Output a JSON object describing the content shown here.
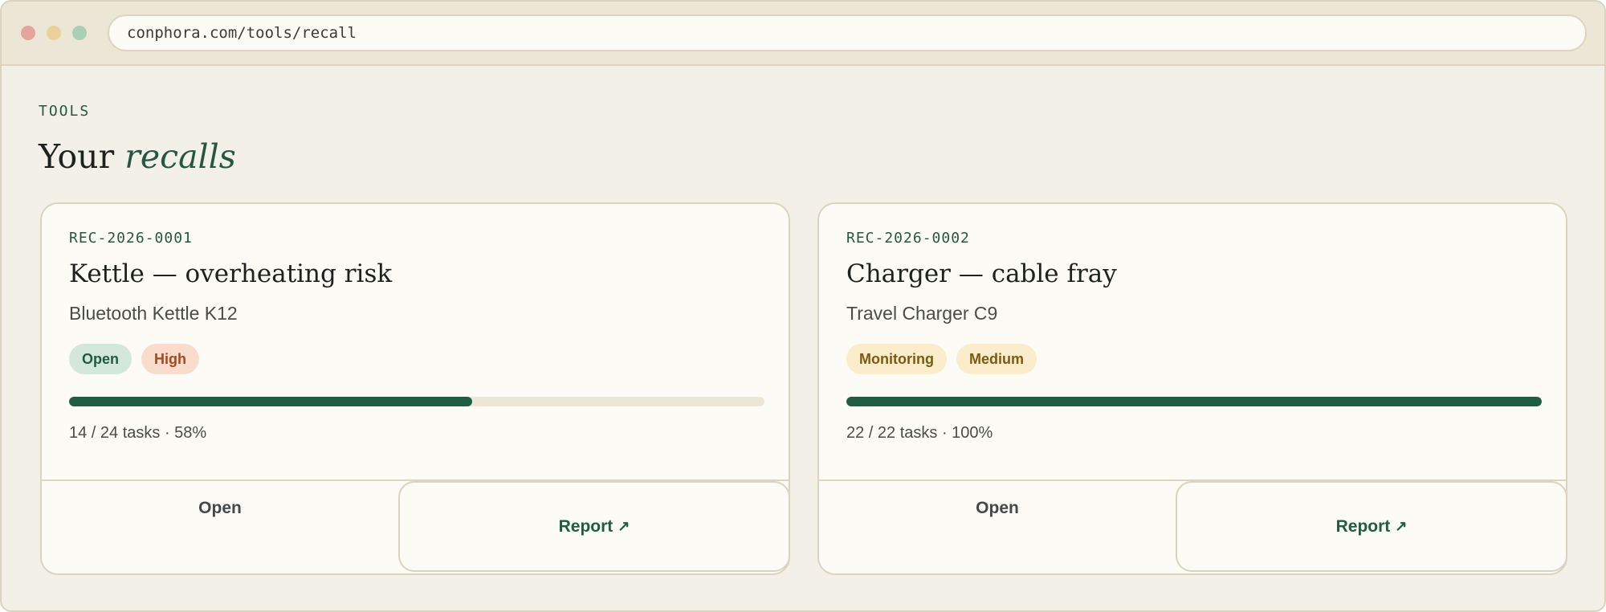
{
  "browser": {
    "url": "conphora.com/tools/recall"
  },
  "page": {
    "eyebrow": "TOOLS",
    "title_prefix": "Your",
    "title_accent": "recalls"
  },
  "recalls": [
    {
      "id": "REC-2026-0001",
      "title": "Kettle — overheating risk",
      "product": "Bluetooth Kettle K12",
      "status": "Open",
      "severity": "High",
      "progress_fraction": 0.58,
      "progress_text": "14 / 24 tasks · 58%",
      "open_label": "Open",
      "report_label": "Report",
      "report_icon": "↗"
    },
    {
      "id": "REC-2026-0002",
      "title": "Charger — cable fray",
      "product": "Travel Charger C9",
      "status": "Monitoring",
      "severity": "Medium",
      "progress_fraction": 1.0,
      "progress_text": "22 / 22 tasks · 100%",
      "open_label": "Open",
      "report_label": "Report",
      "report_icon": "↗"
    }
  ],
  "colors": {
    "brand_green": "#1f5c43",
    "background": "#f3f0e8",
    "card": "#fdfbf6"
  }
}
